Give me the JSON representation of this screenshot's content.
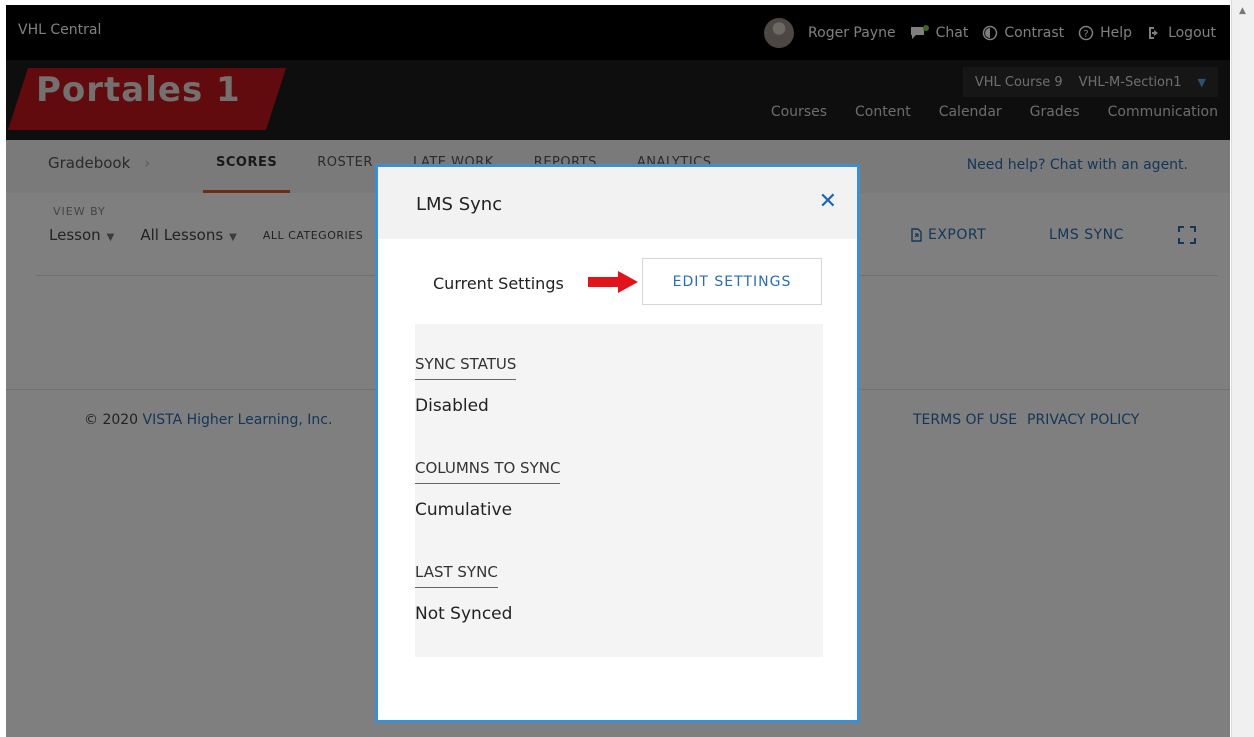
{
  "topbar": {
    "brand": "VHL Central",
    "user_name": "Roger Payne",
    "chat": "Chat",
    "contrast": "Contrast",
    "help": "Help",
    "logout": "Logout"
  },
  "header": {
    "logo": "Portales 1",
    "course": "VHL Course 9",
    "section": "VHL-M-Section1",
    "nav": [
      "Courses",
      "Content",
      "Calendar",
      "Grades",
      "Communication"
    ]
  },
  "subbar": {
    "breadcrumb": "Gradebook",
    "tabs": [
      "SCORES",
      "ROSTER",
      "LATE WORK",
      "REPORTS",
      "ANALYTICS"
    ],
    "help_link": "Need help? Chat with an agent."
  },
  "toolbar": {
    "view_by_label": "VIEW BY",
    "view_by_value": "Lesson",
    "lessons_value": "All Lessons",
    "category_value": "ALL CATEGORIES",
    "export": "EXPORT",
    "lms_sync": "LMS SYNC"
  },
  "footer": {
    "copyright_prefix": "© 2020",
    "copyright_link": "VISTA Higher Learning, Inc.",
    "terms": "TERMS OF USE",
    "privacy": "PRIVACY POLICY"
  },
  "modal": {
    "title": "LMS Sync",
    "current_settings_label": "Current Settings",
    "edit_button": "EDIT SETTINGS",
    "fields": [
      {
        "label": "SYNC STATUS",
        "value": "Disabled"
      },
      {
        "label": "COLUMNS TO SYNC",
        "value": "Cumulative"
      },
      {
        "label": "LAST SYNC",
        "value": "Not Synced"
      }
    ]
  },
  "colors": {
    "accent_blue": "#2a6db3",
    "modal_border": "#3b8ed0",
    "logo_red": "#c4161c",
    "arrow_red": "#e3121b",
    "active_tab_underline": "#e0562b"
  }
}
